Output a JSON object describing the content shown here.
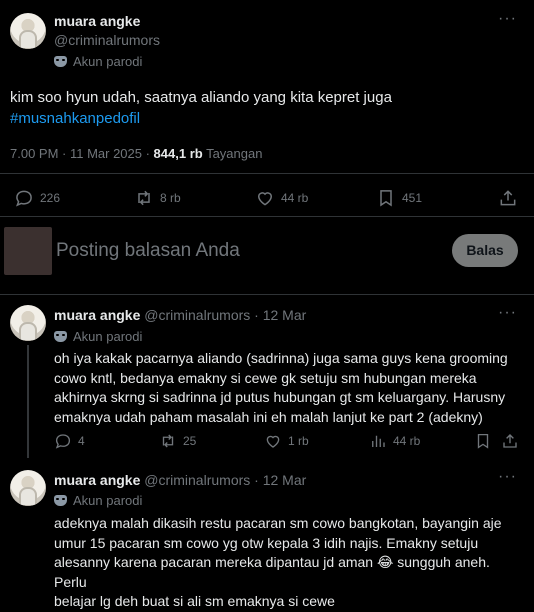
{
  "main_post": {
    "display_name": "muara angke",
    "handle": "@criminalrumors",
    "parody_label": "Akun parodi",
    "text": "kim soo hyun udah, saatnya aliando yang kita kepret juga",
    "hashtag": "#musnahkanpedofil",
    "timestamp": "7.00 PM · 11 Mar 2025 · ",
    "views_count": "844,1 rb",
    "views_label": " Tayangan",
    "stats": {
      "replies": "226",
      "reposts": "8 rb",
      "likes": "44 rb",
      "bookmarks": "451"
    }
  },
  "composer": {
    "placeholder": "Posting balasan Anda",
    "reply_button": "Balas"
  },
  "replies": [
    {
      "display_name": "muara angke",
      "handle": "@criminalrumors",
      "date": "· 12 Mar",
      "parody_label": "Akun parodi",
      "lines": [
        "oh iya kakak pacarnya aliando (sadrinna) juga sama guys kena grooming",
        "cowo kntl, bedanya emakny si cewe gk setuju sm hubungan mereka",
        "akhirnya skrng si sadrinna jd putus hubungan gt sm keluargany. Harusny",
        "emaknya udah paham masalah ini eh malah lanjut ke part 2 (adekny)"
      ],
      "stats": {
        "replies": "4",
        "reposts": "25",
        "likes": "1 rb",
        "views": "44 rb"
      }
    },
    {
      "display_name": "muara angke",
      "handle": "@criminalrumors",
      "date": "· 12 Mar",
      "parody_label": "Akun parodi",
      "lines": [
        "adeknya malah dikasih restu pacaran sm cowo bangkotan, bayangin aje",
        "umur 15 pacaran sm cowo yg otw kepala 3 idih najis. Emakny setuju",
        "alesanny karena pacaran mereka dipantau jd aman 😂 sungguh aneh. Perlu",
        "belajar lg deh buat si ali sm emaknya si cewe"
      ]
    }
  ]
}
